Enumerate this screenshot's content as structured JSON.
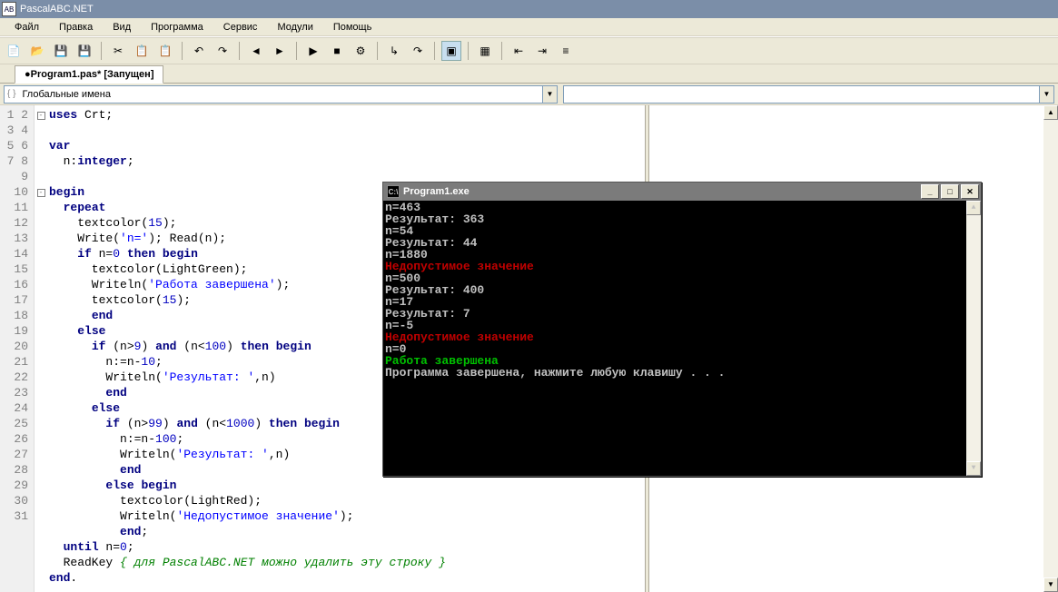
{
  "title": "PascalABC.NET",
  "menu": [
    "Файл",
    "Правка",
    "Вид",
    "Программа",
    "Сервис",
    "Модули",
    "Помощь"
  ],
  "tab": "●Program1.pas* [Запущен]",
  "combo": {
    "namespace_icon": "{ }",
    "namespace": "Глобальные имена"
  },
  "gutter_lines": 31,
  "code": [
    {
      "t": "uses",
      "c": "kw"
    },
    {
      "t": " Crt;\n"
    },
    {
      "t": "\n"
    },
    {
      "t": "var",
      "c": "kw"
    },
    {
      "t": "\n"
    },
    {
      "t": "  n:"
    },
    {
      "t": "integer",
      "c": "kw"
    },
    {
      "t": ";\n"
    },
    {
      "t": "\n"
    },
    {
      "t": "begin",
      "c": "kw"
    },
    {
      "t": "\n"
    },
    {
      "t": "  "
    },
    {
      "t": "repeat",
      "c": "kw"
    },
    {
      "t": "\n"
    },
    {
      "t": "    textcolor("
    },
    {
      "t": "15",
      "c": "num"
    },
    {
      "t": ");\n"
    },
    {
      "t": "    Write("
    },
    {
      "t": "'n='",
      "c": "str"
    },
    {
      "t": "); Read(n);\n"
    },
    {
      "t": "    "
    },
    {
      "t": "if",
      "c": "kw"
    },
    {
      "t": " n="
    },
    {
      "t": "0",
      "c": "num"
    },
    {
      "t": " "
    },
    {
      "t": "then",
      "c": "kw"
    },
    {
      "t": " "
    },
    {
      "t": "begin",
      "c": "kw"
    },
    {
      "t": "\n"
    },
    {
      "t": "      textcolor(LightGreen);\n"
    },
    {
      "t": "      Writeln("
    },
    {
      "t": "'Работа завершена'",
      "c": "str"
    },
    {
      "t": ");\n"
    },
    {
      "t": "      textcolor("
    },
    {
      "t": "15",
      "c": "num"
    },
    {
      "t": ");\n"
    },
    {
      "t": "      "
    },
    {
      "t": "end",
      "c": "kw"
    },
    {
      "t": "\n"
    },
    {
      "t": "    "
    },
    {
      "t": "else",
      "c": "kw"
    },
    {
      "t": "\n"
    },
    {
      "t": "      "
    },
    {
      "t": "if",
      "c": "kw"
    },
    {
      "t": " (n>"
    },
    {
      "t": "9",
      "c": "num"
    },
    {
      "t": ") "
    },
    {
      "t": "and",
      "c": "kw"
    },
    {
      "t": " (n<"
    },
    {
      "t": "100",
      "c": "num"
    },
    {
      "t": ") "
    },
    {
      "t": "then",
      "c": "kw"
    },
    {
      "t": " "
    },
    {
      "t": "begin",
      "c": "kw"
    },
    {
      "t": "\n"
    },
    {
      "t": "        n:=n-"
    },
    {
      "t": "10",
      "c": "num"
    },
    {
      "t": ";\n"
    },
    {
      "t": "        Writeln("
    },
    {
      "t": "'Результат: '",
      "c": "str"
    },
    {
      "t": ",n)\n"
    },
    {
      "t": "        "
    },
    {
      "t": "end",
      "c": "kw"
    },
    {
      "t": "\n"
    },
    {
      "t": "      "
    },
    {
      "t": "else",
      "c": "kw"
    },
    {
      "t": "\n"
    },
    {
      "t": "        "
    },
    {
      "t": "if",
      "c": "kw"
    },
    {
      "t": " (n>"
    },
    {
      "t": "99",
      "c": "num"
    },
    {
      "t": ") "
    },
    {
      "t": "and",
      "c": "kw"
    },
    {
      "t": " (n<"
    },
    {
      "t": "1000",
      "c": "num"
    },
    {
      "t": ") "
    },
    {
      "t": "then",
      "c": "kw"
    },
    {
      "t": " "
    },
    {
      "t": "begin",
      "c": "kw"
    },
    {
      "t": "\n"
    },
    {
      "t": "          n:=n-"
    },
    {
      "t": "100",
      "c": "num"
    },
    {
      "t": ";\n"
    },
    {
      "t": "          Writeln("
    },
    {
      "t": "'Результат: '",
      "c": "str"
    },
    {
      "t": ",n)\n"
    },
    {
      "t": "          "
    },
    {
      "t": "end",
      "c": "kw"
    },
    {
      "t": "\n"
    },
    {
      "t": "        "
    },
    {
      "t": "else",
      "c": "kw"
    },
    {
      "t": " "
    },
    {
      "t": "begin",
      "c": "kw"
    },
    {
      "t": "\n"
    },
    {
      "t": "          textcolor(LightRed);\n"
    },
    {
      "t": "          Writeln("
    },
    {
      "t": "'Недопустимое значение'",
      "c": "str"
    },
    {
      "t": ");\n"
    },
    {
      "t": "          "
    },
    {
      "t": "end",
      "c": "kw"
    },
    {
      "t": ";\n"
    },
    {
      "t": "  "
    },
    {
      "t": "until",
      "c": "kw"
    },
    {
      "t": " n="
    },
    {
      "t": "0",
      "c": "num"
    },
    {
      "t": ";\n"
    },
    {
      "t": "  ReadKey "
    },
    {
      "t": "{ для PascalABC.NET можно удалить эту строку }",
      "c": "cmt"
    },
    {
      "t": "\n"
    },
    {
      "t": "end",
      "c": "kw"
    },
    {
      "t": "."
    }
  ],
  "console": {
    "title": "Program1.exe",
    "lines": [
      {
        "t": "n=463"
      },
      {
        "t": "Результат: 363"
      },
      {
        "t": "n=54"
      },
      {
        "t": "Результат: 44"
      },
      {
        "t": "n=1880"
      },
      {
        "t": "Недопустимое значение",
        "c": "con-red"
      },
      {
        "t": "n=500"
      },
      {
        "t": "Результат: 400"
      },
      {
        "t": "n=17"
      },
      {
        "t": "Результат: 7"
      },
      {
        "t": "n=-5"
      },
      {
        "t": "Недопустимое значение",
        "c": "con-red"
      },
      {
        "t": "n=0"
      },
      {
        "t": "Работа завершена",
        "c": "con-green"
      },
      {
        "t": "Программа завершена, нажмите любую клавишу . . ."
      }
    ]
  },
  "toolbar_icons": [
    {
      "name": "new-file-icon",
      "g": "📄"
    },
    {
      "name": "open-file-icon",
      "g": "📂"
    },
    {
      "name": "save-icon",
      "g": "💾"
    },
    {
      "name": "save-all-icon",
      "g": "💾"
    },
    {
      "sep": true
    },
    {
      "name": "cut-icon",
      "g": "✂"
    },
    {
      "name": "copy-icon",
      "g": "📋"
    },
    {
      "name": "paste-icon",
      "g": "📋"
    },
    {
      "sep": true
    },
    {
      "name": "undo-icon",
      "g": "↶"
    },
    {
      "name": "redo-icon",
      "g": "↷"
    },
    {
      "sep": true
    },
    {
      "name": "nav-back-icon",
      "g": "◄"
    },
    {
      "name": "nav-fwd-icon",
      "g": "►"
    },
    {
      "sep": true
    },
    {
      "name": "run-icon",
      "g": "▶"
    },
    {
      "name": "stop-icon",
      "g": "■"
    },
    {
      "name": "compile-icon",
      "g": "⚙"
    },
    {
      "sep": true
    },
    {
      "name": "step-into-icon",
      "g": "↳"
    },
    {
      "name": "step-over-icon",
      "g": "↷"
    },
    {
      "sep": true
    },
    {
      "name": "console-run-icon",
      "g": "▣",
      "active": true
    },
    {
      "sep": true
    },
    {
      "name": "form-view-icon",
      "g": "▦"
    },
    {
      "sep": true
    },
    {
      "name": "indent-left-icon",
      "g": "⇤"
    },
    {
      "name": "indent-right-icon",
      "g": "⇥"
    },
    {
      "name": "format-icon",
      "g": "≡"
    }
  ]
}
